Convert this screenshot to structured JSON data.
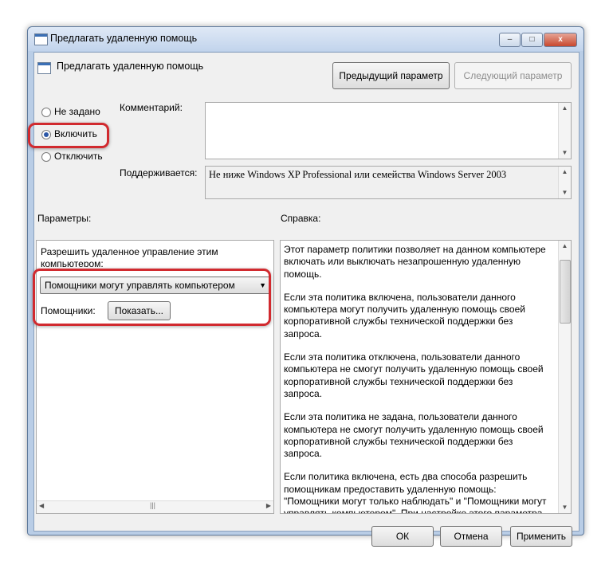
{
  "window": {
    "title": "Предлагать удаленную помощь",
    "title_buttons": {
      "minimize": "–",
      "maximize": "□",
      "close": "x"
    }
  },
  "header": {
    "setting_name": "Предлагать удаленную помощь",
    "prev_button": "Предыдущий параметр",
    "next_button": "Следующий параметр"
  },
  "state": {
    "options": [
      {
        "label": "Не задано",
        "selected": false
      },
      {
        "label": "Включить",
        "selected": true
      },
      {
        "label": "Отключить",
        "selected": false
      }
    ]
  },
  "comment": {
    "label": "Комментарий:",
    "value": ""
  },
  "supported": {
    "label": "Поддерживается:",
    "value": "Не ниже Windows XP Professional или семейства Windows Server 2003"
  },
  "options_panel": {
    "label": "Параметры:",
    "allow_label": "Разрешить удаленное управление этим компьютером:",
    "dropdown_value": "Помощники могут управлять компьютером",
    "helpers_label": "Помощники:",
    "show_button": "Показать..."
  },
  "help_panel": {
    "label": "Справка:",
    "paragraphs": [
      "Этот параметр политики позволяет на данном компьютере включать или выключать незапрошенную удаленную помощь.",
      "Если эта политика включена, пользователи данного компьютера могут получить удаленную помощь своей корпоративной службы технической поддержки без запроса.",
      "Если эта политика отключена, пользователи данного компьютера не смогут получить удаленную помощь своей корпоративной службы технической поддержки без запроса.",
      "Если эта политика не задана, пользователи данного компьютера не смогут получить удаленную помощь своей корпоративной службы технической поддержки без запроса.",
      "Если политика включена, есть два способа разрешить помощникам предоставить удаленную помощь: \"Помощники могут только наблюдать\" и \"Помощники могут управлять компьютером\". При настройке этого параметра"
    ]
  },
  "footer": {
    "ok": "ОК",
    "cancel": "Отмена",
    "apply": "Применить"
  },
  "colors": {
    "highlight": "#d12a2f",
    "radio_dot": "#2b56a6"
  }
}
